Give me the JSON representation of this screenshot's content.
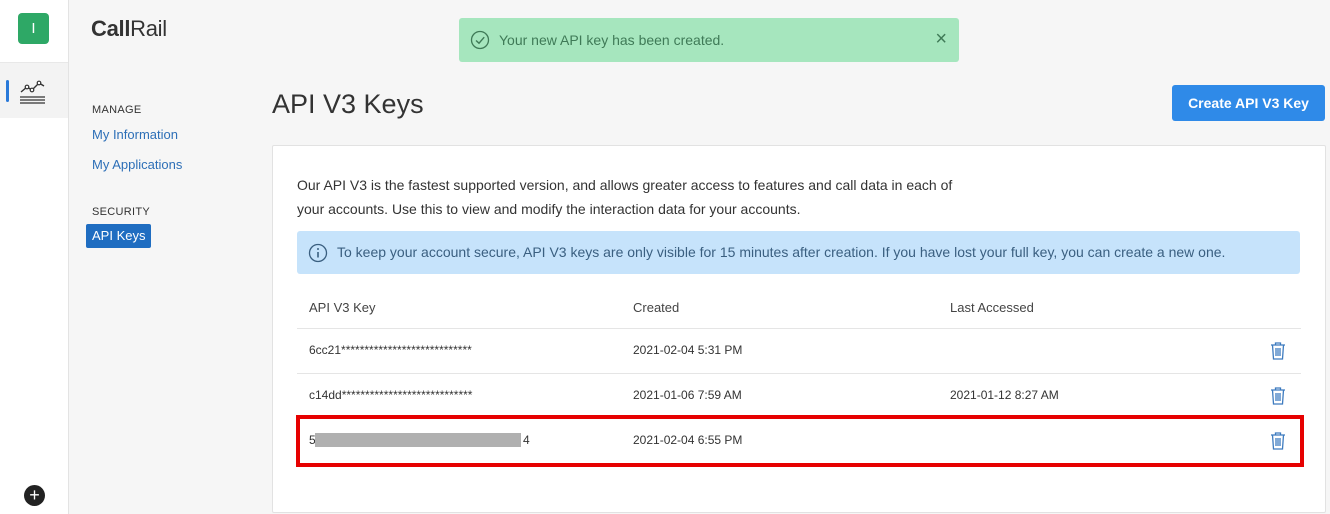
{
  "rail": {
    "avatar_letter": "I",
    "items": [
      {
        "icon": "analytics-chart-icon"
      }
    ],
    "bottom_icon": "plus-circle-icon"
  },
  "brand": {
    "call": "Call",
    "rail": "Rail"
  },
  "nav": {
    "manage_heading": "MANAGE",
    "manage_items": [
      {
        "label": "My Information"
      },
      {
        "label": "My Applications"
      }
    ],
    "security_heading": "SECURITY",
    "security_items": [
      {
        "label": "API Keys",
        "active": true
      }
    ]
  },
  "toast": {
    "message": "Your new API key has been created.",
    "icon": "check-circle-icon",
    "close": "×"
  },
  "page": {
    "title": "API V3 Keys",
    "create_button": "Create API V3 Key"
  },
  "card": {
    "description": "Our API V3 is the fastest supported version, and allows greater access to features and call data in each of your accounts. Use this to view and modify the interaction data for your accounts.",
    "info": "To keep your account secure, API V3 keys are only visible for 15 minutes after creation. If you have lost your full key, you can create a new one.",
    "columns": {
      "key": "API V3 Key",
      "created": "Created",
      "last_accessed": "Last Accessed"
    },
    "rows": [
      {
        "key": "6cc21****************************",
        "created": "2021-02-04 5:31 PM",
        "last_accessed": ""
      },
      {
        "key": "c14dd****************************",
        "created": "2021-01-06 7:59 AM",
        "last_accessed": "2021-01-12 8:27 AM"
      },
      {
        "key_start": "5",
        "key_end": "4",
        "created": "2021-02-04 6:55 PM",
        "last_accessed": "",
        "highlighted": true
      }
    ]
  },
  "colors": {
    "accent": "#2f8ae8",
    "success_bg": "#a6e6be",
    "info_bg": "#c6e3fb",
    "highlight": "#e60000",
    "avatar": "#2ea866"
  }
}
